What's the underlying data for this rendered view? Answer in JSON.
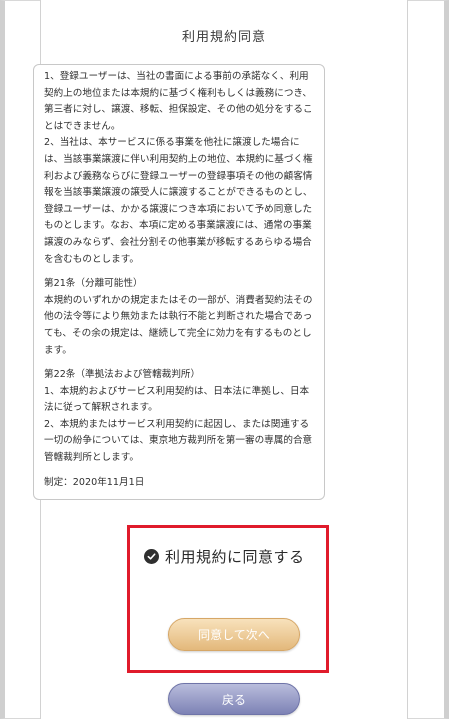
{
  "page": {
    "title": "利用規約同意"
  },
  "terms": {
    "paragraphs": [
      "1、登録ユーザーは、当社の書面による事前の承諾なく、利用契約上の地位または本規約に基づく権利もしくは義務につき、第三者に対し、譲渡、移転、担保設定、その他の処分をすることはできません。",
      "2、当社は、本サービスに係る事業を他社に譲渡した場合には、当該事業譲渡に伴い利用契約上の地位、本規約に基づく権利および義務ならびに登録ユーザーの登録事項その他の顧客情報を当該事業譲渡の譲受人に譲渡することができるものとし、登録ユーザーは、かかる譲渡につき本項において予め同意したものとします。なお、本項に定める事業譲渡には、通常の事業譲渡のみならず、会社分割その他事業が移転するあらゆる場合を含むものとします。",
      "第21条（分離可能性）",
      "本規約のいずれかの規定またはその一部が、消費者契約法その他の法令等により無効または執行不能と判断された場合であっても、その余の規定は、継続して完全に効力を有するものとします。",
      "第22条（準拠法および管轄裁判所）",
      "1、本規約およびサービス利用契約は、日本法に準拠し、日本法に従って解釈されます。",
      "2、本規約またはサービス利用契約に起因し、または関連する一切の紛争については、東京地方裁判所を第一審の専属的合意管轄裁判所とします。",
      "制定：2020年11月1日"
    ]
  },
  "agreement": {
    "checkbox_label": "利用規約に同意する",
    "checked": true
  },
  "buttons": {
    "next_label": "同意して次へ",
    "back_label": "戻る"
  },
  "colors": {
    "highlight_border": "#e01b2b",
    "next_button": "#e3b87b",
    "back_button": "#7d82b5"
  }
}
